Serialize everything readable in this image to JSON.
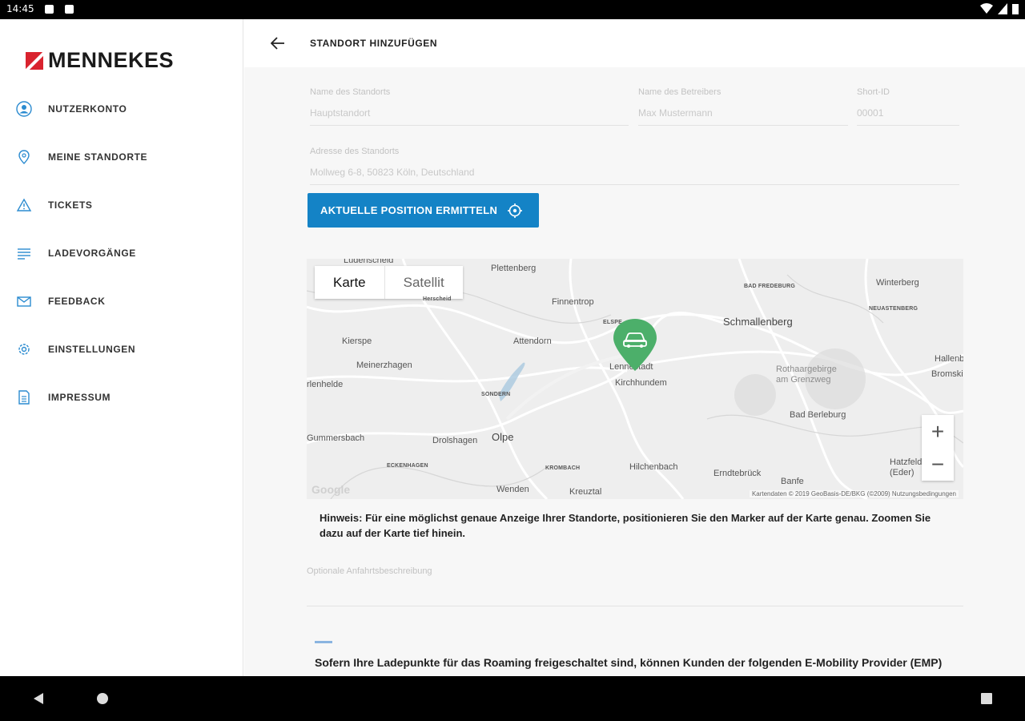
{
  "statusbar": {
    "time": "14:45"
  },
  "brand": {
    "name": "MENNEKES",
    "accent": "#d9232e"
  },
  "nav": {
    "items": [
      {
        "label": "NUTZERKONTO",
        "icon": "user-icon"
      },
      {
        "label": "MEINE STANDORTE",
        "icon": "location-pin-icon"
      },
      {
        "label": "TICKETS",
        "icon": "warning-triangle-icon"
      },
      {
        "label": "LADEVORGÄNGE",
        "icon": "list-lines-icon"
      },
      {
        "label": "FEEDBACK",
        "icon": "envelope-icon"
      },
      {
        "label": "EINSTELLUNGEN",
        "icon": "gear-icon"
      },
      {
        "label": "IMPRESSUM",
        "icon": "document-icon"
      }
    ]
  },
  "header": {
    "title": "STANDORT HINZUFÜGEN",
    "back_icon": "arrow-left-icon"
  },
  "form": {
    "site_name": {
      "label": "Name des Standorts",
      "placeholder": "Hauptstandort"
    },
    "operator_name": {
      "label": "Name des Betreibers",
      "placeholder": "Max Mustermann"
    },
    "short_id": {
      "label": "Short-ID",
      "placeholder": "00001"
    },
    "address": {
      "label": "Adresse des Standorts",
      "placeholder": "Mollweg 6-8, 50823 Köln, Deutschland"
    },
    "locate_button": "AKTUELLE POSITION ERMITTELN",
    "optional_label": "Optionale Anfahrtsbeschreibung"
  },
  "map": {
    "type_karte": "Karte",
    "type_satellit": "Satellit",
    "zoom_in": "+",
    "zoom_out": "−",
    "attribution": "Kartendaten © 2019 GeoBasis-DE/BKG (©2009)    Nutzungsbedingungen",
    "google": "Google",
    "labels": {
      "luedenscheid": "Lüdenscheid",
      "plettenberg": "Plettenberg",
      "herscheid": "Herscheid",
      "finnentrop": "Finnentrop",
      "bad_fredeburg": "BAD FREDEBURG",
      "winterberg": "Winterberg",
      "meschede": "NEUASTENBERG",
      "schmallenberg": "Schmallenberg",
      "kierspe": "Kierspe",
      "attendorn": "Attendorn",
      "hallenberg": "Hallenb.",
      "meinerzhagen": "Meinerzhagen",
      "lennestadt": "Lennestadt",
      "rothaargebirge": "Rothaargebirge am Grenzweg",
      "bromskirchen": "Bromskirchen",
      "kirchhundem": "Kirchhundem",
      "sondern": "SONDERN",
      "marienheide": "rlenhelde",
      "bad_berleburg": "Bad Berleburg",
      "wiehl": "Gummersbach",
      "drolshagen": "Drolshagen",
      "olpe": "Olpe",
      "eckenhagen": "ECKENHAGEN",
      "krombach": "KROMBACH",
      "hilchenbach": "Hilchenbach",
      "erndtebrueck": "Erndtebrück",
      "hatzfeld": "Hatzfeld (Eder)",
      "wenden": "Wenden",
      "kreuztal": "Kreuztal",
      "banfe": "Banfe",
      "eiwa": "ELSPE"
    }
  },
  "hint": "Hinweis: Für eine möglichst genaue Anzeige Ihrer Standorte, positionieren Sie den Marker auf der Karte genau. Zoomen Sie dazu auf der Karte tief hinein.",
  "roaming": "Sofern Ihre Ladepunkte für das Roaming freigeschaltet sind, können Kunden der folgenden E-Mobility Provider (EMP) an diesem Ladepunkt laden:",
  "colors": {
    "primary_button": "#1483c6",
    "pin": "#4caf6a"
  }
}
